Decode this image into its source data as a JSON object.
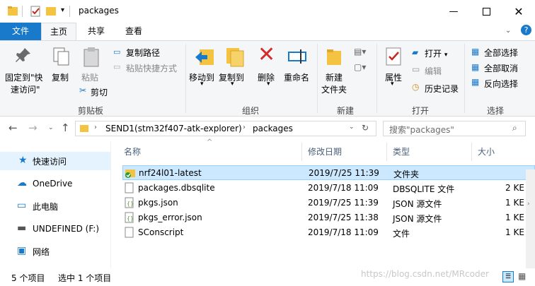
{
  "title": "packages",
  "tabs": {
    "file": "文件",
    "home": "主页",
    "share": "共享",
    "view": "查看"
  },
  "ribbon": {
    "pin_l1": "固定到\"快",
    "pin_l2": "速访问\"",
    "copy": "复制",
    "paste": "粘贴",
    "copy_path": "复制路径",
    "paste_shortcut": "粘贴快捷方式",
    "cut": "剪切",
    "group_clipboard": "剪贴板",
    "move_to": "移动到",
    "copy_to": "复制到",
    "delete": "删除",
    "rename": "重命名",
    "group_organize": "组织",
    "new_folder_l1": "新建",
    "new_folder_l2": "文件夹",
    "group_new": "新建",
    "properties": "属性",
    "open": "打开",
    "edit": "编辑",
    "history": "历史记录",
    "group_open": "打开",
    "select_all": "全部选择",
    "select_none": "全部取消",
    "invert_selection": "反向选择",
    "group_select": "选择"
  },
  "address": {
    "crumb1": "SEND1(stm32f407-atk-explorer)",
    "crumb2": "packages"
  },
  "search": {
    "placeholder": "搜索\"packages\""
  },
  "nav": [
    "快速访问",
    "OneDrive",
    "此电脑",
    "UNDEFINED (F:)",
    "网络"
  ],
  "columns": {
    "name": "名称",
    "date": "修改日期",
    "type": "类型",
    "size": "大小"
  },
  "files": [
    {
      "name": "nrf24l01-latest",
      "date": "2019/7/25 11:39",
      "type": "文件夹",
      "size": ""
    },
    {
      "name": "packages.dbsqlite",
      "date": "2019/7/18 11:09",
      "type": "DBSQLITE 文件",
      "size": "2 KE"
    },
    {
      "name": "pkgs.json",
      "date": "2019/7/25 11:39",
      "type": "JSON 源文件",
      "size": "1 KE"
    },
    {
      "name": "pkgs_error.json",
      "date": "2019/7/25 11:38",
      "type": "JSON 源文件",
      "size": "1 KE"
    },
    {
      "name": "SConscript",
      "date": "2019/7/18 11:09",
      "type": "文件",
      "size": "1 KE"
    }
  ],
  "status": {
    "count": "5 个项目",
    "selected": "选中 1 个项目"
  },
  "watermark": "https://blog.csdn.net/MRcoder",
  "colors": {
    "accent": "#1979ca",
    "selection": "#cce8ff",
    "folder": "#f5c342"
  }
}
